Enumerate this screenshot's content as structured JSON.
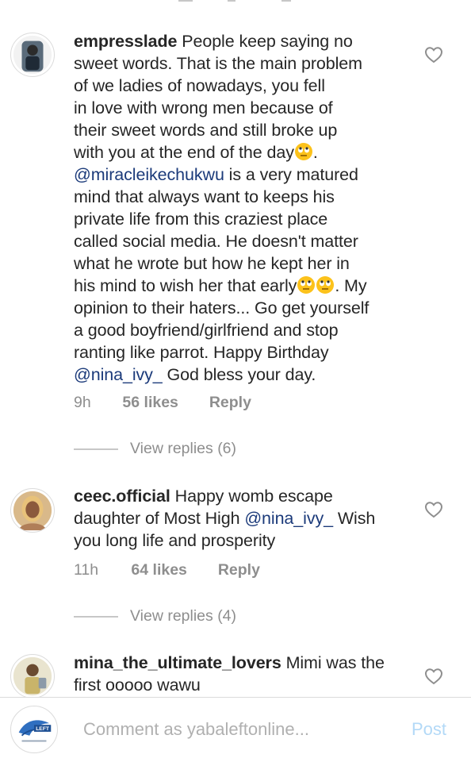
{
  "comments": [
    {
      "username": "empresslade",
      "avatar": "user-avatar-dark-photo",
      "lines": [
        "People keep saying no",
        "sweet words. That is the main problem",
        "of we ladies of nowadays, you fell",
        "in love with wrong men because of",
        "their sweet words and still broke up",
        "with you at the end of the day",
        "@miracleikechukwu",
        "is a very matured",
        "mind that always want to keeps his",
        "private life from this craziest place",
        "called social media. He doesn't matter",
        "what he wrote but how he kept her in",
        "his mind to wish her that early",
        ". My",
        "opinion to their haters... Go get yourself",
        "a good boyfriend/girlfriend  and stop",
        "ranting like parrot. Happy Birthday",
        "@nina_ivy_",
        "God bless your day."
      ],
      "emoji": "face-with-rolling-eyes",
      "time": "9h",
      "likes": "56 likes",
      "reply": "Reply",
      "view_replies": "View replies (6)"
    },
    {
      "username": "ceec.official",
      "avatar": "user-avatar-woman-photo",
      "lines": [
        "Happy womb escape",
        "daughter of Most High",
        "@nina_ivy_",
        "Wish",
        "you long life and prosperity"
      ],
      "time": "11h",
      "likes": "64 likes",
      "reply": "Reply",
      "view_replies": "View replies (4)"
    },
    {
      "username": "mina_the_ultimate_lovers",
      "avatar": "user-avatar-man-photo",
      "lines": [
        "Mimi was the",
        "first ooooo wawu"
      ]
    }
  ],
  "composer": {
    "placeholder": "Comment as yabaleftonline...",
    "post_label": "Post",
    "avatar": "yabaleft-logo",
    "avatar_text": "LEFT"
  },
  "colors": {
    "text": "#262626",
    "muted": "#8e8e8e",
    "mention": "#1b3a7a",
    "post_disabled": "#b3d9f7"
  }
}
